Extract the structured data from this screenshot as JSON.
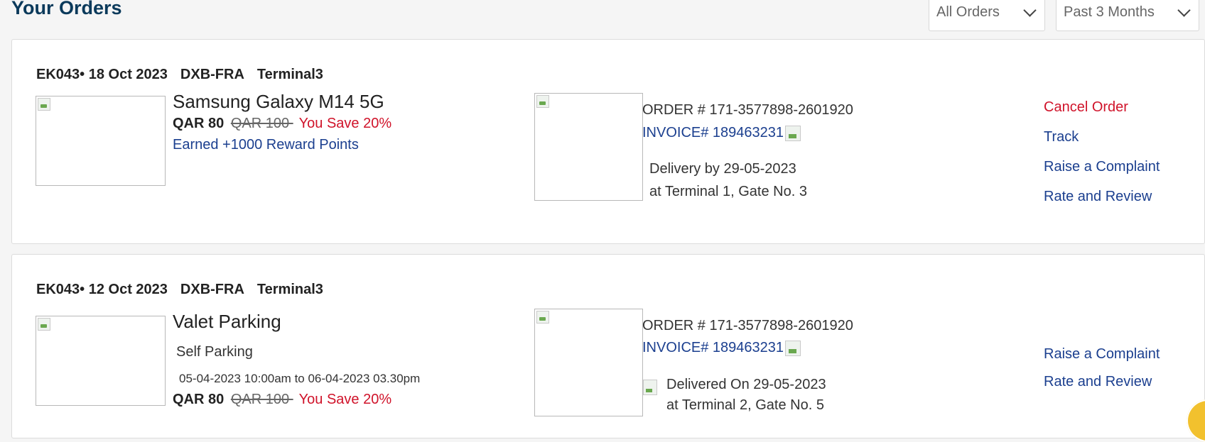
{
  "page": {
    "title": "Your Orders",
    "filters": {
      "type_value": "All Orders",
      "period_value": "Past 3 Months"
    }
  },
  "orders": [
    {
      "flight_no": "EK043• 18 Oct 2023",
      "route": "DXB-FRA",
      "terminal": "Terminal3",
      "product_name": "Samsung Galaxy M14 5G",
      "price": "QAR 80",
      "mrp": "QAR 100 ",
      "savings": "You Save 20%",
      "reward": "Earned +1000 Reward Points",
      "order_number": "ORDER # 171-3577898-2601920",
      "invoice": "INVOICE# 189463231",
      "delivery_status": "Delivery by 29-05-2023",
      "delivery_location": "at Terminal 1, Gate No. 3",
      "actions": [
        "Cancel Order",
        "Track",
        "Raise a Complaint",
        "Rate and Review"
      ]
    },
    {
      "flight_no": "EK043• 12 Oct 2023",
      "route": "DXB-FRA",
      "terminal": "Terminal3",
      "product_name": "Valet Parking",
      "subtype": "Self Parking",
      "duration": "05-04-2023 10:00am to 06-04-2023 03.30pm",
      "price": "QAR 80",
      "mrp": "QAR 100 ",
      "savings": "You Save 20%",
      "order_number": "ORDER # 171-3577898-2601920",
      "invoice": "INVOICE# 189463231",
      "delivery_status": "Delivered On 29-05-2023",
      "delivery_location": "at Terminal 2, Gate No. 5",
      "actions": [
        "Raise a Complaint",
        "Rate and Review"
      ]
    }
  ],
  "colors": {
    "title": "#0b3a5b",
    "link": "#1b3f8f",
    "danger": "#d0132a"
  }
}
